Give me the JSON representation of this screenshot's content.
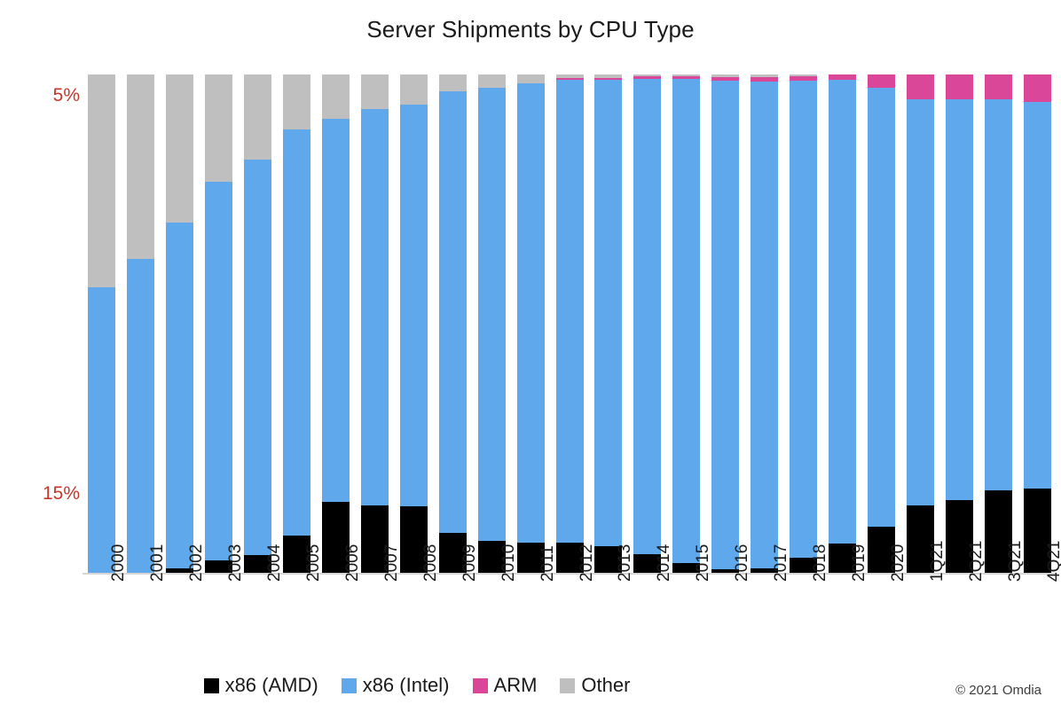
{
  "chart_data": {
    "type": "bar",
    "subtype": "stacked-100-percent-column",
    "title": "Server Shipments by CPU Type",
    "xlabel": "",
    "ylabel": "",
    "ylim": [
      0,
      100
    ],
    "grid": false,
    "legend_position": "bottom",
    "categories": [
      "2000",
      "2001",
      "2002",
      "2003",
      "2004",
      "2005",
      "2006",
      "2007",
      "2008",
      "2009",
      "2010",
      "2011",
      "2012",
      "2013",
      "2014",
      "2015",
      "2016",
      "2017",
      "2018",
      "2019",
      "2020",
      "1Q21",
      "2Q21",
      "3Q21",
      "4Q21"
    ],
    "y_tick_labels": [
      "5%",
      "15%"
    ],
    "y_tick_values": [
      79.3,
      18.1
    ],
    "y_tick_color": "#C0392B",
    "series": [
      {
        "name": "x86 (AMD)",
        "color": "#000000",
        "values": [
          0.0,
          0.0,
          0.9,
          2.5,
          3.6,
          7.5,
          14.2,
          13.5,
          13.3,
          8.0,
          6.4,
          6.0,
          6.1,
          5.3,
          3.7,
          2.0,
          0.7,
          0.9,
          3.0,
          5.9,
          9.2,
          13.5,
          14.6,
          16.5,
          16.9
        ]
      },
      {
        "name": "x86 (Intel)",
        "color": "#5FA8EB",
        "values": [
          57.3,
          63.0,
          69.4,
          76.0,
          79.3,
          81.5,
          76.9,
          79.5,
          80.7,
          88.6,
          91.0,
          92.3,
          92.8,
          93.6,
          95.5,
          97.1,
          98.1,
          97.7,
          95.8,
          93.0,
          88.2,
          81.6,
          80.4,
          78.6,
          77.6
        ]
      },
      {
        "name": "ARM",
        "color": "#DA4698",
        "values": [
          0.0,
          0.0,
          0.0,
          0.0,
          0.0,
          0.0,
          0.0,
          0.0,
          0.0,
          0.0,
          0.0,
          0.0,
          0.4,
          0.4,
          0.4,
          0.5,
          0.7,
          0.8,
          0.9,
          1.1,
          2.6,
          4.9,
          5.0,
          4.9,
          5.5
        ]
      },
      {
        "name": "Other",
        "color": "#BFBFBF",
        "values": [
          42.7,
          37.0,
          29.7,
          21.5,
          17.1,
          11.0,
          8.9,
          7.0,
          6.0,
          3.4,
          2.6,
          1.7,
          0.7,
          0.7,
          0.4,
          0.4,
          0.5,
          0.6,
          0.3,
          0.0,
          0.0,
          0.0,
          0.0,
          0.0,
          0.0
        ]
      }
    ]
  },
  "legend": {
    "items": [
      {
        "label": "x86 (AMD)",
        "color": "#000000"
      },
      {
        "label": "x86 (Intel)",
        "color": "#5FA8EB"
      },
      {
        "label": "ARM",
        "color": "#DA4698"
      },
      {
        "label": "Other",
        "color": "#BFBFBF"
      }
    ]
  },
  "footer": {
    "copyright": "© 2021 Omdia"
  }
}
